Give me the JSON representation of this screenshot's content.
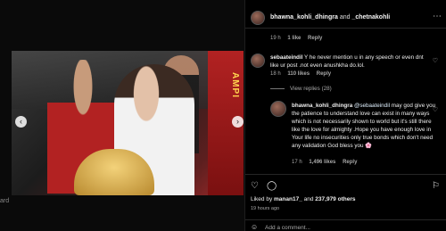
{
  "left": {
    "edge_text": "ard"
  },
  "header": {
    "user1": "bhawna_kohli_dhingra",
    "connector": "and",
    "user2": "_chetnakohli",
    "more": "⋯"
  },
  "comments": {
    "prev_meta": {
      "time": "19 h",
      "likes": "1 like",
      "reply": "Reply"
    },
    "c1": {
      "user": "sebaateindil",
      "text": "Y he never mention u in any speech or even dnt like ur post .not even anushkha do.lol.",
      "time": "18 h",
      "likes": "110 likes",
      "reply": "Reply"
    },
    "view_replies": "View replies (28)",
    "r1": {
      "user": "bhawna_kohli_dhingra",
      "mention": "@sebaateindil",
      "text": " may god give you the patience to understand love can exist in many ways which is not necessarily shown to world but it's still there like the love for almighty .Hope you have enough love in Your life no insecurities only true bonds which don't need any validation God bless you 🌸",
      "time": "17 h",
      "likes": "1,496 likes",
      "reply": "Reply"
    }
  },
  "actions": {
    "liked_by_prefix": "Liked by ",
    "liked_user": "manan17_",
    "liked_middle": " and ",
    "liked_others": "237,979 others",
    "time_ago": "19 hours ago",
    "add_placeholder": "Add a comment..."
  },
  "photo": {
    "banner_text": "AMPI"
  }
}
